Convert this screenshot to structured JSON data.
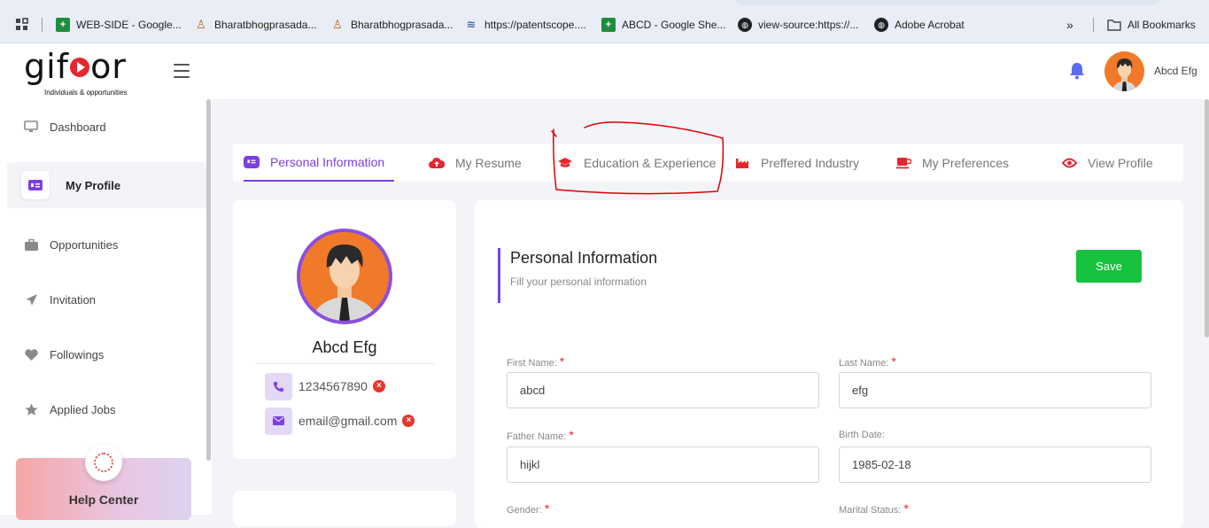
{
  "bookmarks": {
    "items": [
      {
        "label": "WEB-SIDE - Google...",
        "icon": "sheets-icon"
      },
      {
        "label": "Bharatbhogprasada...",
        "icon": "doll-icon"
      },
      {
        "label": "Bharatbhogprasada...",
        "icon": "doll-icon"
      },
      {
        "label": "https://patentscope....",
        "icon": "patentscope-icon"
      },
      {
        "label": "ABCD - Google She...",
        "icon": "sheets-icon"
      },
      {
        "label": "view-source:https://...",
        "icon": "globe-icon"
      },
      {
        "label": "Adobe Acrobat",
        "icon": "globe-icon"
      }
    ],
    "overflow": "»",
    "all_bookmarks": "All Bookmarks"
  },
  "header": {
    "logo": {
      "prefix": "gif",
      "suffix": "or",
      "tagline": "Individuals & opportunities"
    },
    "user_name": "Abcd Efg"
  },
  "sidebar": {
    "items": [
      {
        "label": "Dashboard",
        "icon": "monitor-icon",
        "active": false
      },
      {
        "label": "My Profile",
        "icon": "id-card-icon",
        "active": true
      },
      {
        "label": "Opportunities",
        "icon": "briefcase-icon",
        "active": false
      },
      {
        "label": "Invitation",
        "icon": "paper-plane-icon",
        "active": false
      },
      {
        "label": "Followings",
        "icon": "heart-icon",
        "active": false
      },
      {
        "label": "Applied Jobs",
        "icon": "star-icon",
        "active": false
      }
    ],
    "help": "Help Center"
  },
  "tabs": [
    {
      "label": "Personal Information",
      "icon": "id-card-icon",
      "active": true
    },
    {
      "label": "My Resume",
      "icon": "cloud-upload-icon",
      "active": false
    },
    {
      "label": "Education & Experience",
      "icon": "graduation-cap-icon",
      "active": false
    },
    {
      "label": "Preffered Industry",
      "icon": "industry-icon",
      "active": false
    },
    {
      "label": "My Preferences",
      "icon": "mug-icon",
      "active": false
    },
    {
      "label": "View Profile",
      "icon": "eye-icon",
      "active": false
    }
  ],
  "profile": {
    "name": "Abcd Efg",
    "phone": "1234567890",
    "email": "email@gmail.com"
  },
  "form": {
    "title": "Personal Information",
    "subtitle": "Fill your personal information",
    "save_label": "Save",
    "required_mark": "*",
    "fields": {
      "first_name": {
        "label": "First Name:",
        "value": "abcd",
        "required": true
      },
      "last_name": {
        "label": "Last Name:",
        "value": "efg",
        "required": true
      },
      "father_name": {
        "label": "Father Name:",
        "value": "hijkl",
        "required": true
      },
      "birth_date": {
        "label": "Birth Date:",
        "value": "1985-02-18",
        "required": false
      },
      "gender": {
        "label": "Gender:",
        "value": "",
        "required": true
      },
      "marital_status": {
        "label": "Marital Status:",
        "value": "",
        "required": true
      }
    }
  },
  "colors": {
    "accent": "#7b3fe4",
    "brand_red": "#e6262e",
    "save_green": "#17c23e",
    "annotation": "#e00000"
  }
}
